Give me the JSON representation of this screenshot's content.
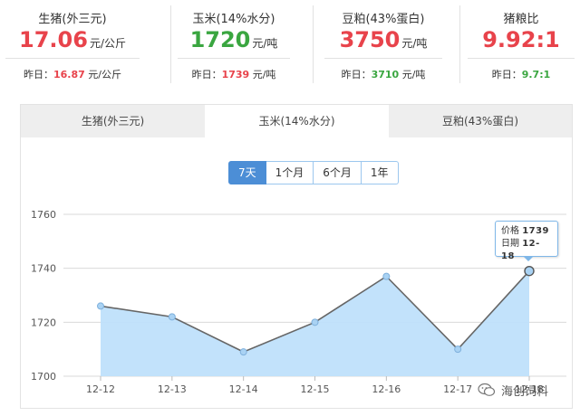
{
  "stats": [
    {
      "name": "生猪(外三元)",
      "value": "17.06",
      "unit": "元/公斤",
      "yesterday_label": "昨日：",
      "yesterday_value": "16.87",
      "yesterday_unit": " 元/公斤",
      "trend": "up"
    },
    {
      "name": "玉米(14%水分)",
      "value": "1720",
      "unit": "元/吨",
      "yesterday_label": "昨日：",
      "yesterday_value": "1739",
      "yesterday_unit": " 元/吨",
      "trend": "down"
    },
    {
      "name": "豆粕(43%蛋白)",
      "value": "3750",
      "unit": "元/吨",
      "yesterday_label": "昨日：",
      "yesterday_value": "3710",
      "yesterday_unit": " 元/吨",
      "trend": "up"
    },
    {
      "name": "猪粮比",
      "value": "9.92:1",
      "unit": "",
      "yesterday_label": "昨日：",
      "yesterday_value": "9.7:1",
      "yesterday_unit": "",
      "trend": "up_green"
    }
  ],
  "tabs": [
    {
      "label": "生猪(外三元)",
      "active": false
    },
    {
      "label": "玉米(14%水分)",
      "active": true
    },
    {
      "label": "豆粕(43%蛋白)",
      "active": false
    }
  ],
  "ranges": [
    {
      "label": "7天",
      "active": true
    },
    {
      "label": "1个月",
      "active": false
    },
    {
      "label": "6个月",
      "active": false
    },
    {
      "label": "1年",
      "active": false
    }
  ],
  "tooltip": {
    "price_label": "价格",
    "price_value": "1739",
    "date_label": "日期",
    "date_value": "12-18"
  },
  "watermark": {
    "text": "海创饲料",
    "icon": "wechat-icon"
  },
  "colors": {
    "red": "#e8434b",
    "green": "#3aa640",
    "area_fill": "#bfe0fb",
    "line": "#666666",
    "active_range": "#4c8ed6"
  },
  "chart_data": {
    "type": "area",
    "x": [
      "12-12",
      "12-13",
      "12-14",
      "12-15",
      "12-16",
      "12-17",
      "12-18"
    ],
    "values": [
      1726,
      1722,
      1709,
      1720,
      1737,
      1710,
      1739
    ],
    "ylim": [
      1700,
      1760
    ],
    "yticks": [
      1700,
      1720,
      1740,
      1760
    ],
    "highlighted_index": 6,
    "grid": true
  }
}
